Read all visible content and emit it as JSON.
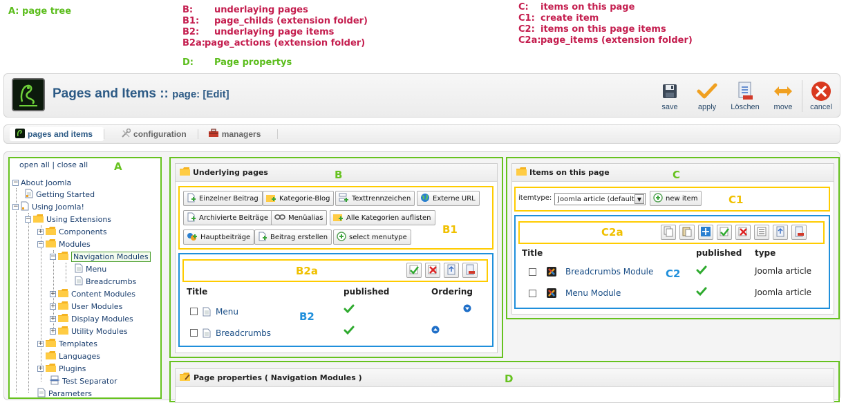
{
  "legend": {
    "a": "A: page tree",
    "b_rows": [
      {
        "key": "B:",
        "text": "underlaying pages"
      },
      {
        "key": "B1:",
        "text": "page_childs (extension folder)"
      },
      {
        "key": "B2:",
        "text": "underlaying page items"
      },
      {
        "key": "B2a:",
        "text": "page_actions  (extension folder)"
      }
    ],
    "c_rows": [
      {
        "key": "C:",
        "text": "items on this page"
      },
      {
        "key": "C1:",
        "text": "create item"
      },
      {
        "key": "C2:",
        "text": "items on this page items"
      },
      {
        "key": "C2a:",
        "text": "page_items  (extension folder)"
      }
    ],
    "d": {
      "key": "D:",
      "text": "Page propertys"
    },
    "colors": {
      "green": "#5bbd1c",
      "red": "#c41d4e",
      "yellow": "#ffcc00",
      "blue": "#1f8fdb"
    }
  },
  "header": {
    "title": "Pages and Items :: ",
    "subtitle": "page: [Edit]",
    "toolbar": [
      {
        "label": "save",
        "icon": "save-icon"
      },
      {
        "label": "apply",
        "icon": "checkmark-icon"
      },
      {
        "label": "Löschen",
        "icon": "delete-icon"
      },
      {
        "label": "move",
        "icon": "move-icon"
      },
      {
        "label": "cancel",
        "icon": "cancel-icon"
      }
    ]
  },
  "tabs": [
    {
      "label": "pages and items",
      "active": true
    },
    {
      "label": "configuration",
      "active": false
    },
    {
      "label": "managers",
      "active": false
    }
  ],
  "tree": {
    "open_all": "open all",
    "separator": "|",
    "close_all": "close all",
    "nodes": [
      "About Joomla",
      "Getting Started",
      "Using Joomla!",
      "Using Extensions",
      "Components",
      "Modules",
      "Navigation Modules",
      "Menu",
      "Breadcrumbs",
      "Content Modules",
      "User Modules",
      "Display Modules",
      "Utility Modules",
      "Templates",
      "Languages",
      "Plugins",
      "Test Separator",
      "Parameters"
    ]
  },
  "underlying": {
    "title": "Underlying pages",
    "buttons": [
      "Einzelner Beitrag",
      "Kategorie-Blog",
      "Texttrennzeichen",
      "Externe URL",
      "Archivierte Beiträge",
      "Menüalias",
      "Alle Kategorien auflisten",
      "Hauptbeiträge",
      "Beitrag erstellen",
      "select menutype"
    ],
    "columns": {
      "title": "Title",
      "published": "published",
      "ordering": "Ordering"
    },
    "rows": [
      {
        "title": "Menu",
        "ordering": "down"
      },
      {
        "title": "Breadcrumbs",
        "ordering": "up"
      }
    ]
  },
  "items": {
    "title": "Items on this page",
    "itemtype_label": "itemtype:",
    "itemtype_value": "Joomla article (default)",
    "new_item": "new item",
    "columns": {
      "title": "Title",
      "published": "published",
      "type": "type"
    },
    "rows": [
      {
        "title": "Breadcrumbs Module",
        "type": "Joomla article"
      },
      {
        "title": "Menu Module",
        "type": "Joomla article"
      }
    ]
  },
  "properties": {
    "title": "Page properties ( Navigation Modules )"
  },
  "tags": {
    "a": "A",
    "b": "B",
    "b1": "B1",
    "b2": "B2",
    "b2a": "B2a",
    "c": "C",
    "c1": "C1",
    "c2": "C2",
    "c2a": "C2a",
    "d": "D"
  }
}
